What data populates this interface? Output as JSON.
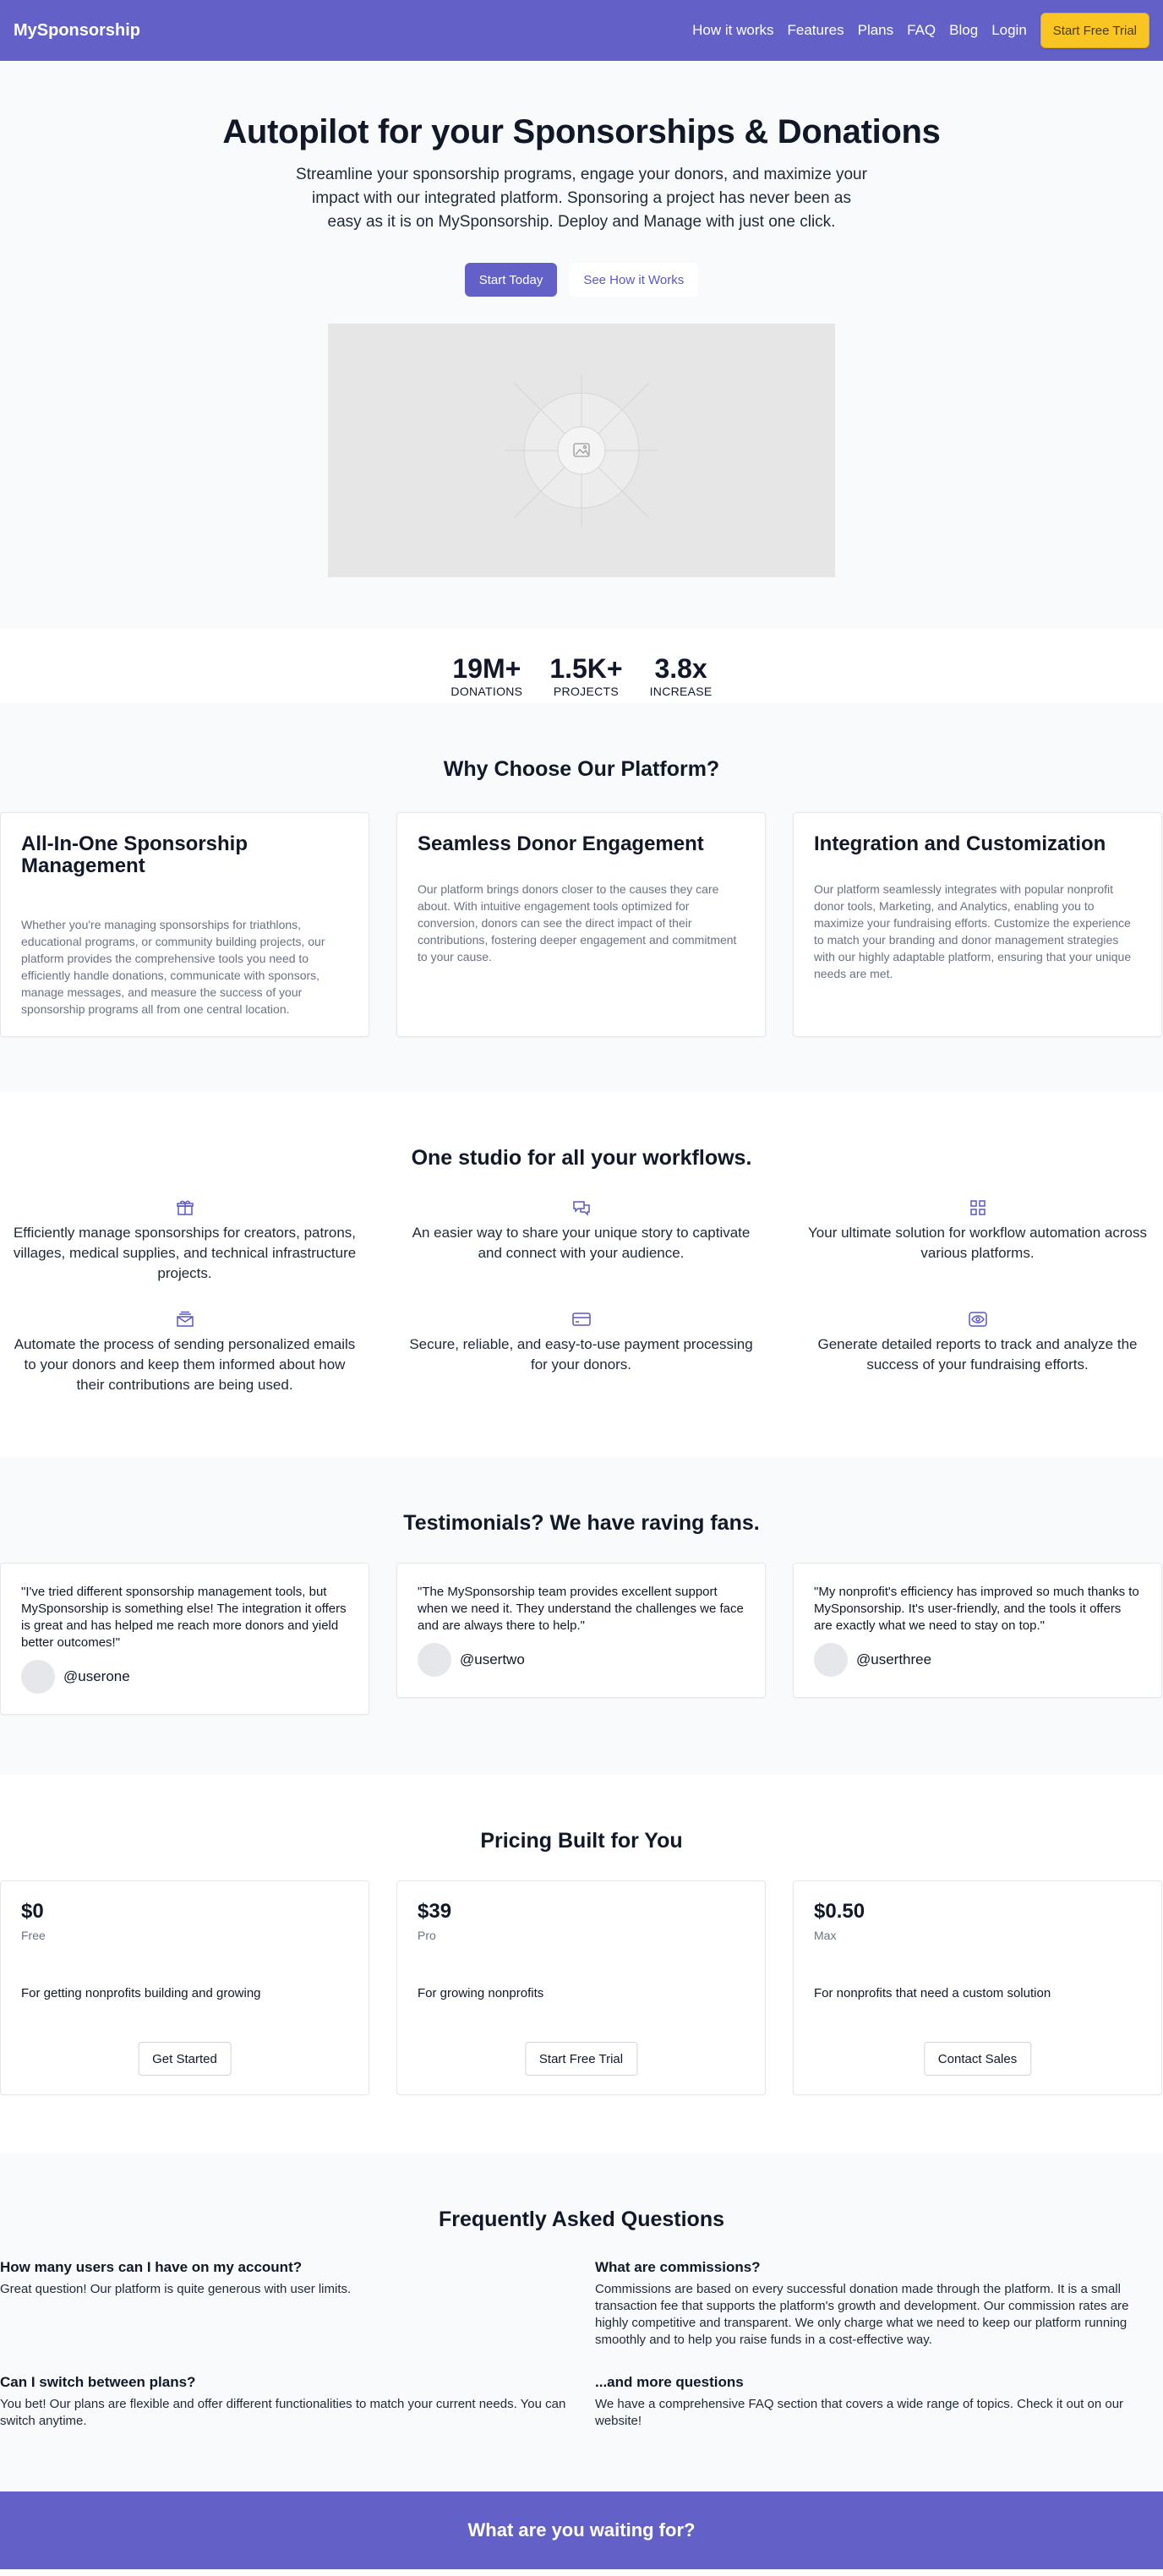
{
  "nav": {
    "brand": "MySponsorship",
    "links": [
      "How it works",
      "Features",
      "Plans",
      "FAQ",
      "Blog",
      "Login"
    ],
    "cta": "Start Free Trial"
  },
  "hero": {
    "title": "Autopilot for your Sponsorships & Donations",
    "subtitle": "Streamline your sponsorship programs, engage your donors, and maximize your impact with our integrated platform. Sponsoring a project has never been as easy as it is on MySponsorship. Deploy and Manage with just one click.",
    "primary_button": "Start Today",
    "secondary_button": "See How it Works",
    "media_icon": "image-placeholder-icon"
  },
  "stats": [
    {
      "value": "19M+",
      "label": "DONATIONS"
    },
    {
      "value": "1.5K+",
      "label": "PROJECTS"
    },
    {
      "value": "3.8x",
      "label": "INCREASE"
    }
  ],
  "why": {
    "title": "Why Choose Our Platform?",
    "cards": [
      {
        "title": "All-In-One Sponsorship Management",
        "body": "Whether you're managing sponsorships for triathlons, educational programs, or community building projects, our platform provides the comprehensive tools you need to efficiently handle donations, communicate with sponsors, manage messages, and measure the success of your sponsorship programs all from one central location."
      },
      {
        "title": "Seamless Donor Engagement",
        "body": "Our platform brings donors closer to the causes they care about. With intuitive engagement tools optimized for conversion, donors can see the direct impact of their contributions, fostering deeper engagement and commitment to your cause."
      },
      {
        "title": "Integration and Customization",
        "body": "Our platform seamlessly integrates with popular nonprofit donor tools, Marketing, and Analytics, enabling you to maximize your fundraising efforts. Customize the experience to match your branding and donor management strategies with our highly adaptable platform, ensuring that your unique needs are met."
      }
    ]
  },
  "workflows": {
    "title": "One studio for all your workflows.",
    "items": [
      {
        "icon": "gift-icon",
        "text": "Efficiently manage sponsorships for creators, patrons, villages, medical supplies, and technical infrastructure projects."
      },
      {
        "icon": "chat-bubbles-icon",
        "text": "An easier way to share your unique story to captivate and connect with your audience."
      },
      {
        "icon": "grid-icon",
        "text": "Your ultimate solution for workflow automation across various platforms."
      },
      {
        "icon": "mail-stack-icon",
        "text": "Automate the process of sending personalized emails to your donors and keep them informed about how their contributions are being used."
      },
      {
        "icon": "credit-card-icon",
        "text": "Secure, reliable, and easy-to-use payment processing for your donors."
      },
      {
        "icon": "eye-icon",
        "text": "Generate detailed reports to track and analyze the success of your fundraising efforts."
      }
    ]
  },
  "testimonials": {
    "title": "Testimonials? We have raving fans.",
    "items": [
      {
        "quote": "\"I've tried different sponsorship management tools, but MySponsorship is something else! The integration it offers is great and has helped me reach more donors and yield better outcomes!\"",
        "handle": "@userone"
      },
      {
        "quote": "\"The MySponsorship team provides excellent support when we need it. They understand the challenges we face and are always there to help.\"",
        "handle": "@usertwo"
      },
      {
        "quote": "\"My nonprofit's efficiency has improved so much thanks to MySponsorship. It's user-friendly, and the tools it offers are exactly what we need to stay on top.\"",
        "handle": "@userthree"
      }
    ]
  },
  "pricing": {
    "title": "Pricing Built for You",
    "plans": [
      {
        "price": "$0",
        "tier": "Free",
        "desc": "For getting nonprofits building and growing",
        "button": "Get Started"
      },
      {
        "price": "$39",
        "tier": "Pro",
        "desc": "For growing nonprofits",
        "button": "Start Free Trial"
      },
      {
        "price": "$0.50",
        "tier": "Max",
        "desc": "For nonprofits that need a custom solution",
        "button": "Contact Sales"
      }
    ]
  },
  "faq": {
    "title": "Frequently Asked Questions",
    "items": [
      {
        "q": "How many users can I have on my account?",
        "a": "Great question! Our platform is quite generous with user limits."
      },
      {
        "q": "What are commissions?",
        "a": "Commissions are based on every successful donation made through the platform. It is a small transaction fee that supports the platform's growth and development. Our commission rates are highly competitive and transparent. We only charge what we need to keep our platform running smoothly and to help you raise funds in a cost-effective way."
      },
      {
        "q": "Can I switch between plans?",
        "a": "You bet! Our plans are flexible and offer different functionalities to match your current needs. You can switch anytime."
      },
      {
        "q": "...and more questions",
        "a": "We have a comprehensive FAQ section that covers a wide range of topics. Check it out on our website!"
      }
    ]
  },
  "cta": {
    "title": "What are you waiting for?"
  },
  "colors": {
    "brand": "#6360c8",
    "accent": "#f8c523"
  }
}
